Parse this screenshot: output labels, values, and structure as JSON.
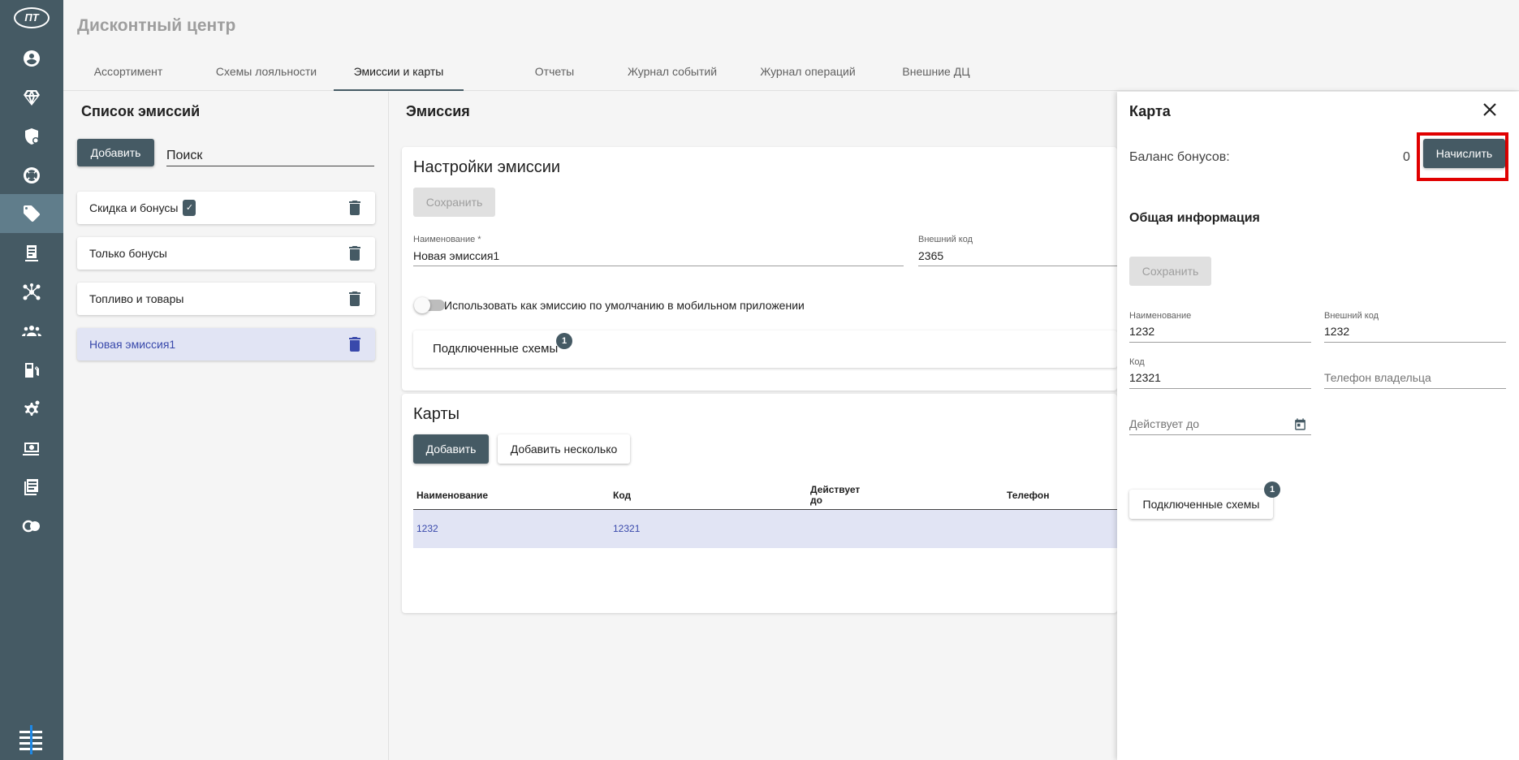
{
  "app": {
    "logo_text": "ПТ",
    "title": "Дисконтный центр"
  },
  "rail": {
    "items": [
      "profile-icon",
      "diamond-icon",
      "shield-icon",
      "lifebuoy-icon",
      "tag-icon",
      "receipt-icon",
      "network-icon",
      "users-icon",
      "fuel-icon",
      "settings-gear-icon",
      "money-icon",
      "list-icon",
      "circles-icon"
    ],
    "active": "tag-icon"
  },
  "tabs": [
    "Ассортимент",
    "Схемы лояльности",
    "Эмиссии и карты",
    "Отчеты",
    "Журнал событий",
    "Журнал операций",
    "Внешние ДЦ"
  ],
  "active_tab": "Эмиссии и карты",
  "emission_list": {
    "title": "Список эмиссий",
    "add_label": "Добавить",
    "search_placeholder": "Поиск",
    "items": [
      {
        "label": "Скидка и бонусы",
        "badge": true
      },
      {
        "label": "Только бонусы",
        "badge": false
      },
      {
        "label": "Топливо и товары",
        "badge": false
      },
      {
        "label": "Новая эмиссия1",
        "badge": false,
        "selected": true
      }
    ]
  },
  "emission": {
    "title": "Эмиссия",
    "settings": {
      "title": "Настройки эмиссии",
      "save_label": "Сохранить",
      "name_label": "Наименование *",
      "name_value": "Новая эмиссия1",
      "ext_code_label": "Внешний код",
      "ext_code_value": "2365",
      "toggle_label": "Использовать как эмиссию по умолчанию в мобильном приложении",
      "toggle_on": false,
      "schemes_label": "Подключенные схемы",
      "schemes_count": "1"
    },
    "cards": {
      "title": "Карты",
      "add_label": "Добавить",
      "add_many_label": "Добавить несколько",
      "columns": [
        "Наименование",
        "Код",
        "Действует до",
        "Телефон"
      ],
      "col3_line1": "Действует",
      "col3_line2": "до",
      "rows": [
        {
          "name": "1232",
          "code": "12321",
          "valid_until": "",
          "phone": ""
        }
      ]
    }
  },
  "card_drawer": {
    "title": "Карта",
    "balance_label": "Баланс бонусов:",
    "balance_value": "0",
    "accrue_label": "Начислить",
    "general_title": "Общая информация",
    "save_label": "Сохранить",
    "name_label": "Наименование",
    "name_value": "1232",
    "ext_code_label": "Внешний код",
    "ext_code_value": "1232",
    "code_label": "Код",
    "code_value": "12321",
    "phone_placeholder": "Телефон владельца",
    "valid_until_placeholder": "Действует до",
    "schemes_label": "Подключенные схемы",
    "schemes_count": "1"
  },
  "colors": {
    "rail_bg": "#455a64",
    "accent": "#455a64",
    "link": "#3949ab",
    "highlight": "#e00000"
  }
}
